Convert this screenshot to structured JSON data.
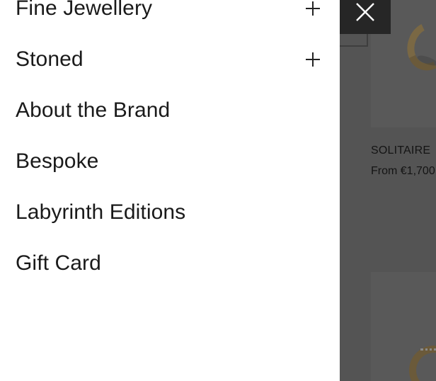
{
  "menu": {
    "items": [
      {
        "label": "Fine Jewellery",
        "expandable": true,
        "icon": "plus-icon"
      },
      {
        "label": "Stoned",
        "expandable": true,
        "icon": "plus-icon"
      },
      {
        "label": "About the Brand",
        "expandable": false
      },
      {
        "label": "Bespoke",
        "expandable": false
      },
      {
        "label": "Labyrinth Editions",
        "expandable": false
      },
      {
        "label": "Gift Card",
        "expandable": false
      }
    ]
  },
  "close_button": {
    "icon": "close-icon"
  },
  "background_product": {
    "name": "SOLITAIRE",
    "price": "From €1,700"
  },
  "colors": {
    "overlay": "#545454",
    "close_bg": "#262626",
    "text": "#1a1a1a"
  }
}
